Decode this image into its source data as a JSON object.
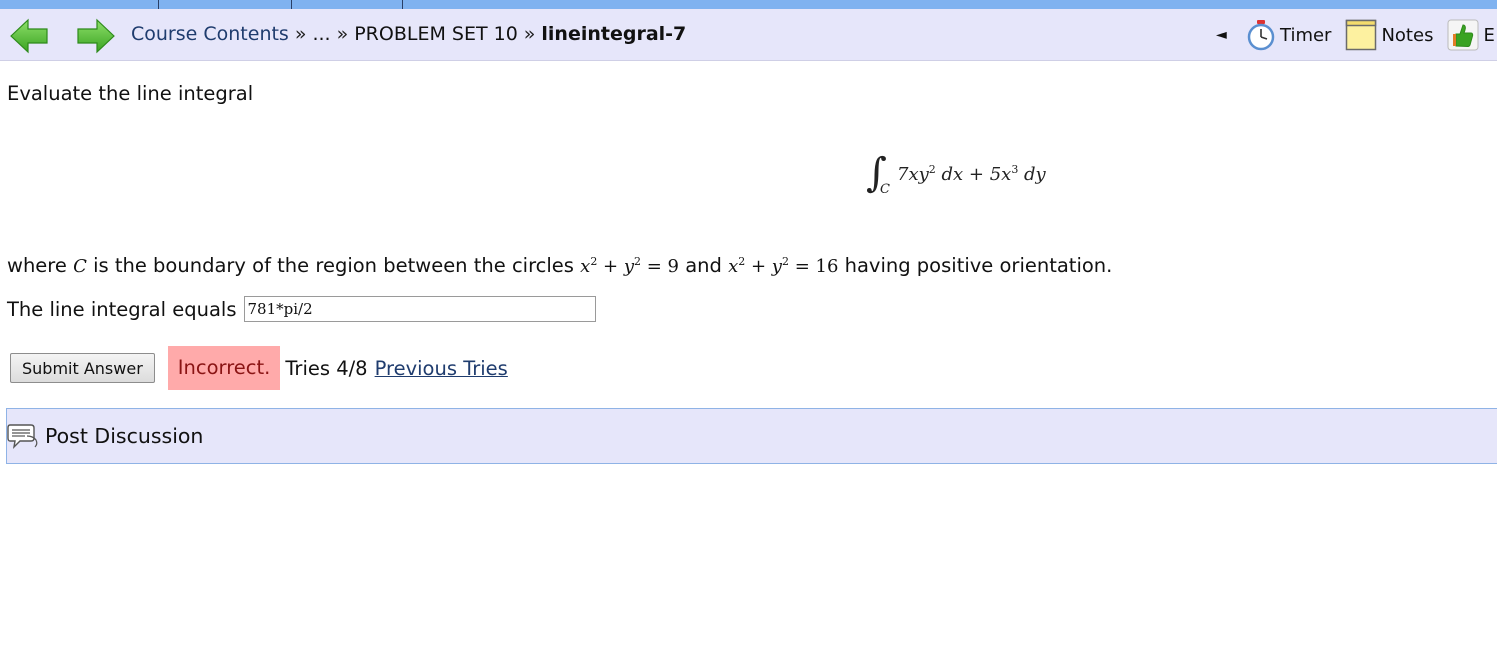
{
  "nav": {
    "breadcrumb": {
      "course_contents": "Course Contents",
      "sep": "»",
      "ellipsis": "...",
      "problem_set": "PROBLEM SET 10",
      "current": "lineintegral-7"
    },
    "tools": {
      "collapse_glyph": "◄",
      "timer_label": "Timer",
      "notes_label": "Notes",
      "evaluate_label": "E"
    },
    "colors": {
      "top_strip": "#7fb2f0",
      "bar": "#e6e6fa",
      "arrow_green": "#55c23a"
    },
    "icons": [
      "back-arrow-icon",
      "forward-arrow-icon",
      "timer-icon",
      "notes-icon",
      "evaluate-icon"
    ]
  },
  "problem": {
    "prompt": "Evaluate the line integral",
    "integral": {
      "sign": "∫",
      "subscript": "C",
      "term1": "7xy",
      "term1_exp": "2",
      "term1_diff": " dx + 5x",
      "term2_exp": "3",
      "term2_diff": " dy"
    },
    "where_prefix": "where ",
    "curve_symbol": "C",
    "where_middle": " is the boundary of the region between the circles ",
    "circle1": {
      "x": "x",
      "exp1": "2",
      "plus": " + y",
      "exp2": "2",
      "eq": " = 9"
    },
    "and_text": " and ",
    "circle2": {
      "x": "x",
      "exp1": "2",
      "plus": " + y",
      "exp2": "2",
      "eq": " = 16"
    },
    "where_suffix": " having positive orientation.",
    "answer_label": "The line integral equals",
    "answer_value": "781*pi/2"
  },
  "submission": {
    "submit_label": "Submit Answer",
    "status": "Incorrect.",
    "tries": "Tries 4/8",
    "previous_tries": "Previous Tries",
    "status_color": "#ffaaaa"
  },
  "discussion": {
    "label": "Post Discussion",
    "icon": "speech-bubble-icon"
  }
}
